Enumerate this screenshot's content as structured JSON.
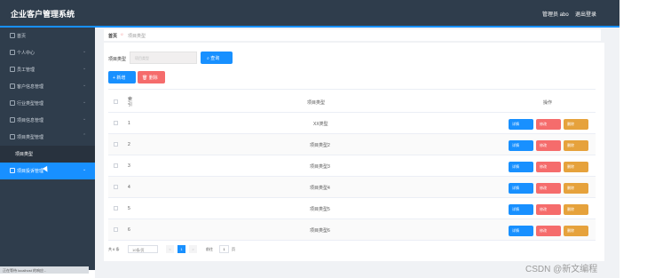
{
  "header": {
    "title": "企业客户管理系统",
    "user_label": "管理员 abo",
    "logout_label": "退出登录"
  },
  "sidebar": {
    "items": [
      {
        "label": "首页",
        "icon": "home-icon",
        "chevron": ""
      },
      {
        "label": "个人中心",
        "icon": "user-icon",
        "chevron": "⌄"
      },
      {
        "label": "员工管理",
        "icon": "staff-icon",
        "chevron": "⌄"
      },
      {
        "label": "客户信息管理",
        "icon": "customer-icon",
        "chevron": "⌄"
      },
      {
        "label": "行业类型管理",
        "icon": "flag-icon",
        "chevron": "⌄"
      },
      {
        "label": "项目信息管理",
        "icon": "doc-icon",
        "chevron": "⌄"
      },
      {
        "label": "项目类型管理",
        "icon": "gear-icon",
        "chevron": "⌃"
      }
    ],
    "sub_item": "项目类型",
    "active_item": {
      "label": "项目投诉管理",
      "icon": "complaint-icon",
      "chevron": "⌄"
    },
    "status_bar": "正在等待 localhost 的响应..."
  },
  "breadcrumb": {
    "home": "首页",
    "separator": "☼",
    "current": "项目类型"
  },
  "search": {
    "label": "项目类型",
    "placeholder": "项目类型",
    "button": "查询"
  },
  "toolbar": {
    "add": "新增",
    "delete": "删除"
  },
  "table": {
    "headers": {
      "index": "索引",
      "type": "项目类型",
      "ops": "操作"
    },
    "rows": [
      {
        "index": "1",
        "type": "XX类型"
      },
      {
        "index": "2",
        "type": "项目类型2"
      },
      {
        "index": "3",
        "type": "项目类型3"
      },
      {
        "index": "4",
        "type": "项目类型4"
      },
      {
        "index": "5",
        "type": "项目类型5"
      },
      {
        "index": "6",
        "type": "项目类型6"
      }
    ],
    "actions": {
      "detail": "详情",
      "edit": "修改",
      "delete": "删除"
    }
  },
  "pagination": {
    "total": "共 6 条",
    "page_size": "10条/页",
    "prev": "<",
    "current": "1",
    "next": ">",
    "goto": "前往",
    "jump_value": "1",
    "page_suffix": "页"
  },
  "watermark": "CSDN @新文编程",
  "colors": {
    "primary": "#1890ff",
    "danger": "#f56c6c",
    "warning": "#e6a23c",
    "sidebar": "#2f3d4c"
  }
}
